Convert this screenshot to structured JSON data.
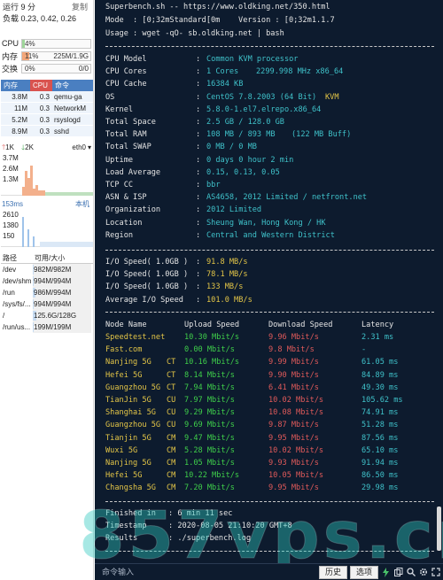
{
  "sidebar": {
    "uptime": "运行 9 分",
    "copy": "复制",
    "load": "负载 0.23, 0.42, 0.26",
    "meters": [
      {
        "label": "CPU",
        "percent_text": "4%",
        "detail": "",
        "fill": 0.04,
        "color": "#9fd69a"
      },
      {
        "label": "内存",
        "percent_text": "11%",
        "detail": "225M/1.9G",
        "fill": 0.11,
        "color": "#f3a77a"
      },
      {
        "label": "交换",
        "percent_text": "0%",
        "detail": "0/0",
        "fill": 0.0,
        "color": "#9fd69a"
      }
    ],
    "process_headers": {
      "mem": "内存",
      "cpu": "CPU",
      "cmd": "命令"
    },
    "processes": [
      {
        "mem": "3.8M",
        "cpu": "0.3",
        "cmd": "qemu-ga"
      },
      {
        "mem": "11M",
        "cpu": "0.3",
        "cmd": "NetworkM"
      },
      {
        "mem": "5.2M",
        "cpu": "0.3",
        "cmd": "rsyslogd"
      },
      {
        "mem": "8.9M",
        "cpu": "0.3",
        "cmd": "sshd"
      }
    ],
    "net": {
      "up": "1K",
      "down": "2K",
      "iface": "eth0",
      "y_labels": [
        "3.7M",
        "2.6M",
        "1.3M"
      ]
    },
    "ping": {
      "value": "153ms",
      "host": "本机",
      "y_labels": [
        "2610",
        "1380",
        "150"
      ]
    },
    "disk_headers": {
      "path": "路径",
      "size": "可用/大小"
    },
    "disks": [
      {
        "path": "/dev",
        "size": "982M/982M",
        "fill": 0.02
      },
      {
        "path": "/dev/shm",
        "size": "994M/994M",
        "fill": 0.02
      },
      {
        "path": "/run",
        "size": "986M/994M",
        "fill": 0.05
      },
      {
        "path": "/sys/fs/...",
        "size": "994M/994M",
        "fill": 0.02
      },
      {
        "path": "/",
        "size": "125.6G/128G",
        "fill": 0.06
      },
      {
        "path": "/run/us...",
        "size": "199M/199M",
        "fill": 0.02
      }
    ]
  },
  "terminal": {
    "header": [
      "Superbench.sh -- https://www.oldking.net/350.html",
      "Mode  : [0;32mStandard[0m    Version : [0;32m1.1.7",
      "Usage : wget -qO- sb.oldking.net | bash"
    ],
    "sysinfo": [
      {
        "k": "CPU Model",
        "v": "Common KVM processor",
        "v2": ""
      },
      {
        "k": "CPU Cores",
        "v": "1 Cores",
        "v2": "2299.998 MHz x86_64"
      },
      {
        "k": "CPU Cache",
        "v": "16384 KB",
        "v2": ""
      },
      {
        "k": "OS",
        "v": "CentOS 7.8.2003 (64 Bit)",
        "v2": "KVM"
      },
      {
        "k": "Kernel",
        "v": "5.8.0-1.el7.elrepo.x86_64",
        "v2": ""
      },
      {
        "k": "Total Space",
        "v": "2.5 GB / 128.0 GB",
        "v2": ""
      },
      {
        "k": "Total RAM",
        "v": "108 MB / 893 MB",
        "v2": "(122 MB Buff)"
      },
      {
        "k": "Total SWAP",
        "v": "0 MB / 0 MB",
        "v2": ""
      },
      {
        "k": "Uptime",
        "v": "0 days 0 hour 2 min",
        "v2": ""
      },
      {
        "k": "Load Average",
        "v": "0.15, 0.13, 0.05",
        "v2": ""
      },
      {
        "k": "TCP CC",
        "v": "bbr",
        "v2": ""
      },
      {
        "k": "ASN & ISP",
        "v": "AS4658, 2012 Limited / netfront.net",
        "v2": ""
      },
      {
        "k": "Organization",
        "v": "2012 Limited",
        "v2": ""
      },
      {
        "k": "Location",
        "v": "Sheung Wan, Hong Kong / HK",
        "v2": ""
      },
      {
        "k": "Region",
        "v": "Central and Western District",
        "v2": ""
      }
    ],
    "io": [
      {
        "k": "I/O Speed( 1.0GB )",
        "v": "91.8 MB/s"
      },
      {
        "k": "I/O Speed( 1.0GB )",
        "v": "78.1 MB/s"
      },
      {
        "k": "I/O Speed( 1.0GB )",
        "v": "133 MB/s"
      },
      {
        "k": "Average I/O Speed",
        "v": "101.0 MB/s"
      }
    ],
    "speed_headers": {
      "node": "Node Name",
      "up": "Upload Speed",
      "down": "Download Speed",
      "lat": "Latency"
    },
    "speed": [
      {
        "node": "Speedtest.net",
        "isp": "",
        "up": "10.30 Mbit/s",
        "down": "9.96 Mbit/s",
        "lat": "2.31 ms"
      },
      {
        "node": "Fast.com",
        "isp": "",
        "up": "0.00 Mbit/s",
        "down": "9.8 Mbit/s",
        "lat": "-"
      },
      {
        "node": "Nanjing 5G",
        "isp": "CT",
        "up": "10.16 Mbit/s",
        "down": "9.99 Mbit/s",
        "lat": "61.05 ms"
      },
      {
        "node": "Hefei 5G",
        "isp": "CT",
        "up": "8.14 Mbit/s",
        "down": "9.90 Mbit/s",
        "lat": "84.89 ms"
      },
      {
        "node": "Guangzhou 5G",
        "isp": "CT",
        "up": "7.94 Mbit/s",
        "down": "6.41 Mbit/s",
        "lat": "49.30 ms"
      },
      {
        "node": "TianJin 5G",
        "isp": "CU",
        "up": "7.97 Mbit/s",
        "down": "10.02 Mbit/s",
        "lat": "105.62 ms"
      },
      {
        "node": "Shanghai 5G",
        "isp": "CU",
        "up": "9.29 Mbit/s",
        "down": "10.08 Mbit/s",
        "lat": "74.91 ms"
      },
      {
        "node": "Guangzhou 5G",
        "isp": "CU",
        "up": "9.69 Mbit/s",
        "down": "9.87 Mbit/s",
        "lat": "51.28 ms"
      },
      {
        "node": "Tianjin 5G",
        "isp": "CM",
        "up": "9.47 Mbit/s",
        "down": "9.95 Mbit/s",
        "lat": "87.56 ms"
      },
      {
        "node": "Wuxi 5G",
        "isp": "CM",
        "up": "5.28 Mbit/s",
        "down": "10.02 Mbit/s",
        "lat": "65.10 ms"
      },
      {
        "node": "Nanjing 5G",
        "isp": "CM",
        "up": "1.05 Mbit/s",
        "down": "9.93 Mbit/s",
        "lat": "91.94 ms"
      },
      {
        "node": "Hefei 5G",
        "isp": "CM",
        "up": "10.22 Mbit/s",
        "down": "10.05 Mbit/s",
        "lat": "86.50 ms"
      },
      {
        "node": "Changsha 5G",
        "isp": "CM",
        "up": "7.20 Mbit/s",
        "down": "9.95 Mbit/s",
        "lat": "29.98 ms"
      }
    ],
    "footer": [
      {
        "k": "Finished in",
        "v": ": 6 min 11 sec"
      },
      {
        "k": "Timestamp",
        "v": ": 2020-08-05 21:10:20 GMT+8"
      },
      {
        "k": "Results",
        "v": ": ./superbench.log"
      }
    ]
  },
  "watermark": "857vps.cn",
  "cmdbar": {
    "placeholder": "命令输入",
    "history": "历史",
    "options": "选项"
  },
  "colors": {
    "terminal_bg": "#0d1b2e",
    "cyan": "#3fc1c9",
    "yellow": "#e3c547",
    "green": "#3fcf4a",
    "red": "#e05a5a"
  }
}
